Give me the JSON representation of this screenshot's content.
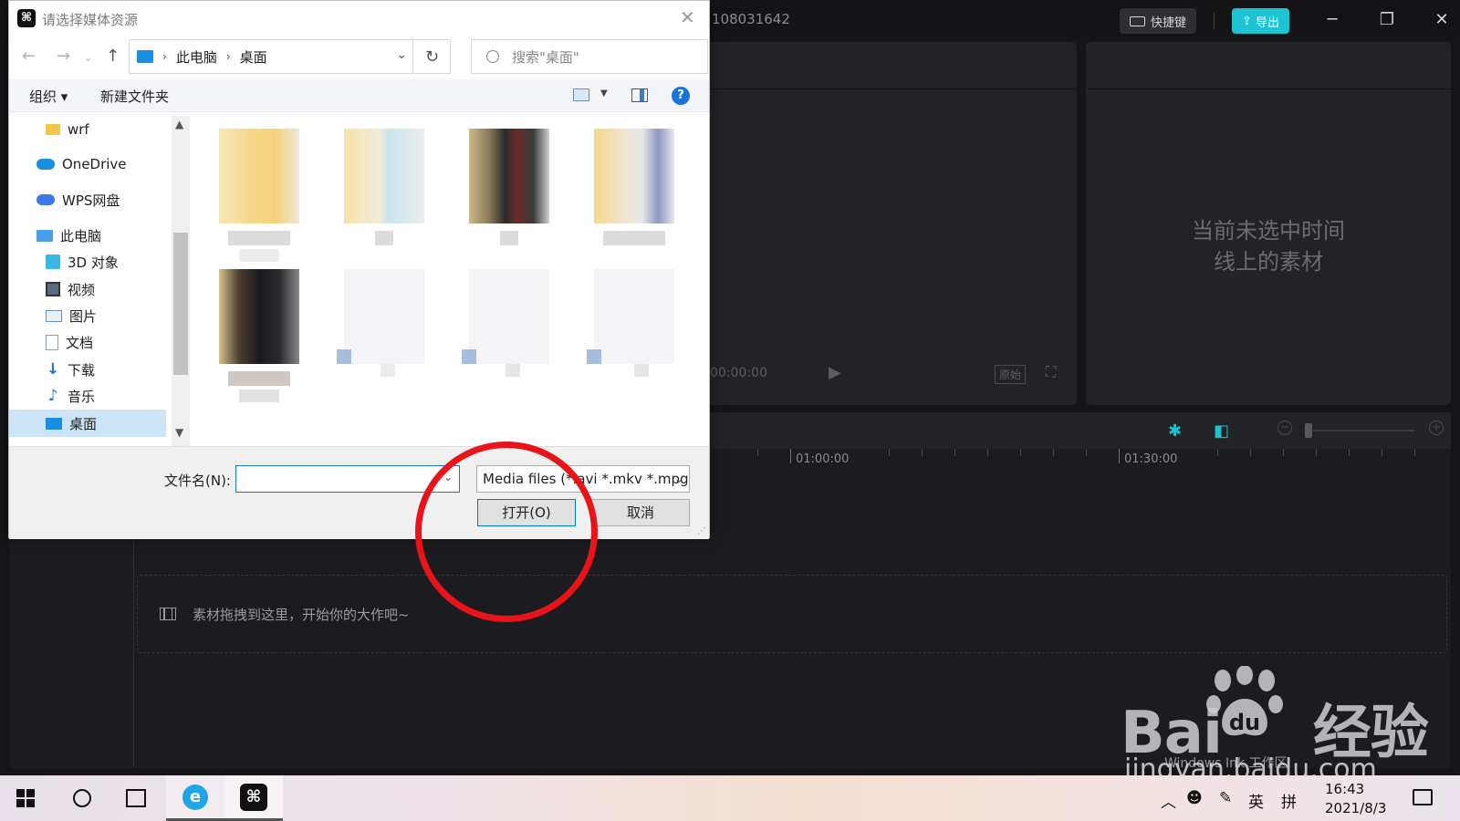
{
  "editor": {
    "title": "108031642",
    "shortcut_label": "快捷键",
    "export_label": "导出",
    "player_time": "00:00:00",
    "player_original": "原始",
    "props_empty_line1": "当前未选中时间",
    "props_empty_line2": "线上的素材",
    "ruler_labels": [
      "01:00:00",
      "01:30:00"
    ],
    "drop_hint": "素材拖拽到这里，开始你的大作吧~",
    "accent_color": "#1ec3d3"
  },
  "dialog": {
    "title": "请选择媒体资源",
    "breadcrumb": [
      "此电脑",
      "桌面"
    ],
    "search_placeholder": "搜索\"桌面\"",
    "toolbar_organize": "组织",
    "toolbar_new_folder": "新建文件夹",
    "tree": [
      {
        "label": "wrf",
        "icon": "folder-icon"
      },
      {
        "label": "OneDrive",
        "icon": "onedrive-icon"
      },
      {
        "label": "WPS网盘",
        "icon": "wps-cloud-icon"
      },
      {
        "label": "此电脑",
        "icon": "this-pc-icon"
      },
      {
        "label": "3D 对象",
        "icon": "3d-objects-icon"
      },
      {
        "label": "视频",
        "icon": "videos-icon"
      },
      {
        "label": "图片",
        "icon": "pictures-icon"
      },
      {
        "label": "文档",
        "icon": "documents-icon"
      },
      {
        "label": "下载",
        "icon": "downloads-icon"
      },
      {
        "label": "音乐",
        "icon": "music-icon"
      },
      {
        "label": "桌面",
        "icon": "desktop-icon",
        "selected": true
      }
    ],
    "filename_label": "文件名(N):",
    "filename_value": "",
    "filter_value": "Media files (*.avi *.mkv *.mpg",
    "open_label": "打开(O)",
    "cancel_label": "取消",
    "thumbnail_count": 8
  },
  "watermark": {
    "brand": "Bai",
    "brand_tail": "经验",
    "site": "jingyan.baidu.com",
    "overlay_text": "Windows Ink 工作区"
  },
  "taskbar": {
    "time": "16:43",
    "date": "2021/8/3",
    "ime_lang": "英",
    "ime_mode": "拼"
  },
  "annotation": {
    "highlight_color": "#e8141a"
  }
}
